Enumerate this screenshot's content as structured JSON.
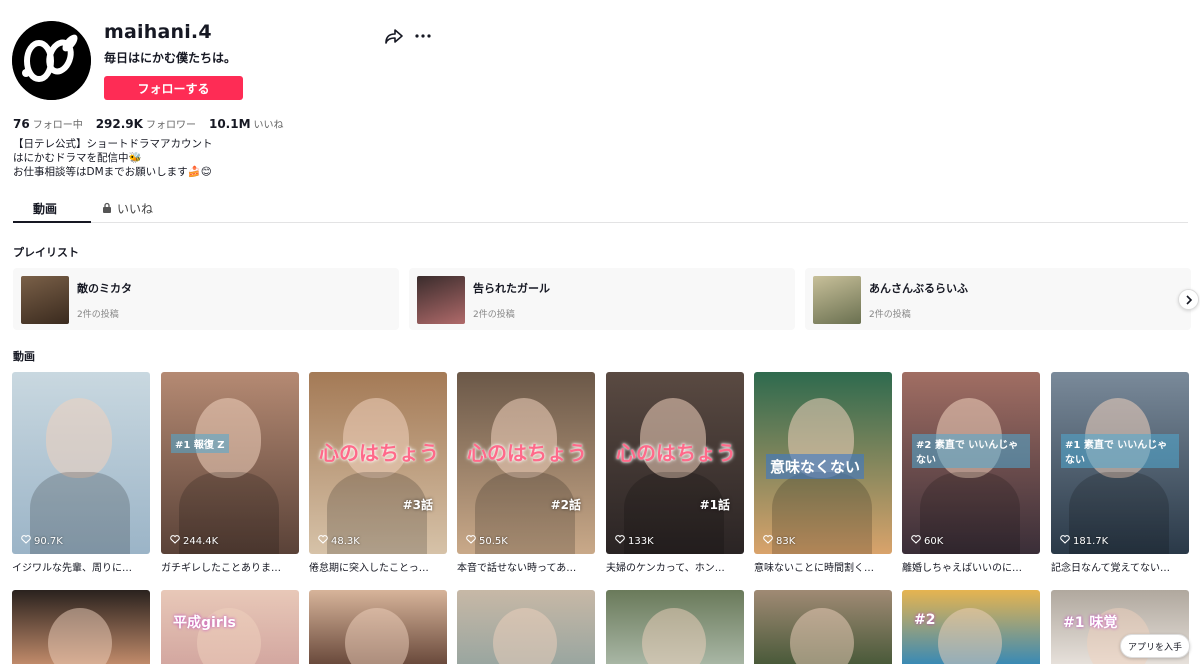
{
  "profile": {
    "username": "maihani.4",
    "nickname": "毎日はにかむ僕たちは。",
    "follow_label": "フォローする",
    "stats": [
      {
        "value": "76",
        "label": "フォロー中"
      },
      {
        "value": "292.9K",
        "label": "フォロワー"
      },
      {
        "value": "10.1M",
        "label": "いいね"
      }
    ],
    "bio": [
      "【日テレ公式】ショートドラマアカウント",
      "はにかむドラマを配信中🐝",
      "お仕事相談等はDMまでお願いします🍰😊"
    ]
  },
  "tabs": [
    {
      "label": "動画",
      "active": true
    },
    {
      "label": "いいね",
      "active": false,
      "locked": true
    }
  ],
  "sections": {
    "playlists": "プレイリスト",
    "videos": "動画"
  },
  "playlists": [
    {
      "title": "敵のミカタ",
      "count": "2件の投稿",
      "thumb_color": "#5a4634"
    },
    {
      "title": "告られたガール",
      "count": "2件の投稿",
      "thumb_color": "#6b4b4b"
    },
    {
      "title": "あんさんぶるらいふ",
      "count": "2件の投稿",
      "thumb_color": "#8a8f6a"
    }
  ],
  "videos": [
    {
      "likes": "90.7K",
      "caption": "イジワルな先輩、周りに…",
      "bg": "#9bb4c7",
      "bg2": "#c9d8e0"
    },
    {
      "likes": "244.4K",
      "caption": "ガチギレしたことありま…",
      "bg": "#5a4238",
      "bg2": "#b58a73",
      "overlay": "#1 報復 Z"
    },
    {
      "likes": "48.3K",
      "caption": "倦怠期に突入したことっ…",
      "bg": "#d6c2a8",
      "bg2": "#a47a56",
      "overlay": "心のはちょう",
      "ep": "#3話"
    },
    {
      "likes": "50.5K",
      "caption": "本音で話せない時ってあ…",
      "bg": "#c9a989",
      "bg2": "#6b5848",
      "overlay": "心のはちょう",
      "ep": "#2話"
    },
    {
      "likes": "133K",
      "caption": "夫婦のケンカって、ホン…",
      "bg": "#2a2424",
      "bg2": "#5a4a42",
      "overlay": "心のはちょう",
      "ep": "#1話"
    },
    {
      "likes": "83K",
      "caption": "意味ないことに時間割く…",
      "bg": "#d9a36b",
      "bg2": "#2e6a4e",
      "overlay": "意味なくない"
    },
    {
      "likes": "60K",
      "caption": "離婚しちゃえばいいのに…",
      "bg": "#3a2e38",
      "bg2": "#a16e63",
      "overlay": "#2 素直で いいんじゃない"
    },
    {
      "likes": "181.7K",
      "caption": "記念日なんて覚えてない…",
      "bg": "#2a3948",
      "bg2": "#7a8a9a",
      "overlay": "#1 素直で いいんじゃない"
    }
  ],
  "videos_row2": [
    {
      "bg": "#c08a6a",
      "bg2": "#2a221e"
    },
    {
      "bg": "#d3a7a0",
      "bg2": "#e8c8b8",
      "overlay": "平成girls"
    },
    {
      "bg": "#6a4a3c",
      "bg2": "#d7b49a"
    },
    {
      "bg": "#9aa6a0",
      "bg2": "#c7b8a6"
    },
    {
      "bg": "#a8b6a4",
      "bg2": "#6a7a5a"
    },
    {
      "bg": "#4a5a3a",
      "bg2": "#a08a74"
    },
    {
      "bg": "#3a8ab4",
      "bg2": "#e6b450",
      "overlay": "#2"
    },
    {
      "bg": "#e6e0da",
      "bg2": "#b0a89e",
      "overlay": "#1 味覚"
    }
  ],
  "app_button": "アプリを入手",
  "colors": {
    "accent": "#fe2c55",
    "text": "#161823"
  }
}
